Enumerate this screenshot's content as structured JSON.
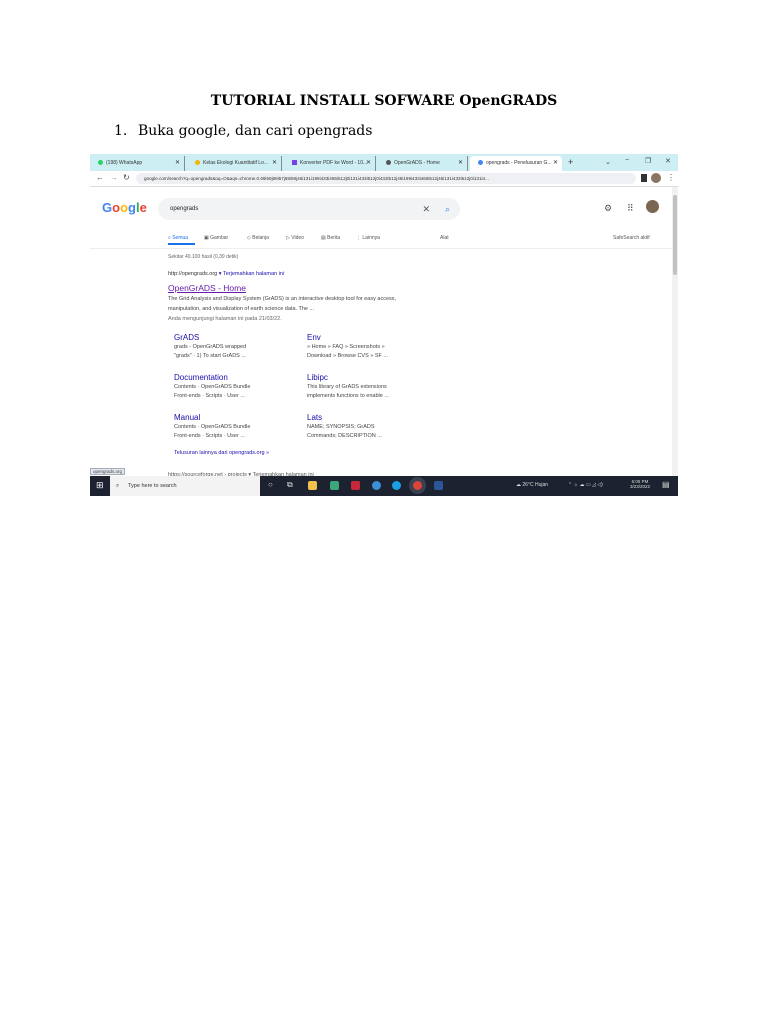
{
  "document": {
    "title": "TUTORIAL INSTALL SOFWARE OpenGRADS",
    "step_number": "1.",
    "step_text": "Buka google, dan cari opengrads"
  },
  "browser": {
    "tabs": [
      {
        "label": "(198) WhatsApp",
        "icon": "whatsapp-icon",
        "color": "#25d366"
      },
      {
        "label": "Kelas Ekologi Kuantitatif Lo...",
        "icon": "classroom-icon",
        "color": "#f4b400"
      },
      {
        "label": "Konverter PDF ke Word - 10...",
        "icon": "pdf-converter-icon",
        "color": "#7b3fe4"
      },
      {
        "label": "OpenGrADS - Home",
        "icon": "globe-icon",
        "color": "#555555"
      },
      {
        "label": "opengrads - Penelusuran G...",
        "icon": "google-icon",
        "color": "#4285f4"
      }
    ],
    "new_tab": "+",
    "window_controls": {
      "dropdown": "⌄",
      "minimize": "−",
      "restore": "❐",
      "close": "✕"
    },
    "url": "google.com/search?q=opengrads&oq=O&aqs=chrome.0.69i59j69i57j69i59j46i131i199i433i465i512j0i131i433i512j0i433i512j46i199i433i465i512j46i131i433i512j0i131i4..."
  },
  "google": {
    "logo": "Google",
    "query": "opengrads",
    "nav": [
      "Semua",
      "Gambar",
      "Belanja",
      "Video",
      "Berita",
      "Lainnya"
    ],
    "tools": "Alat",
    "safesearch": "SafeSearch aktif",
    "stats": "Sekitar 40.100 hasil (0,39 detik)",
    "result": {
      "url": "http://opengrads.org",
      "translate": "▾ Terjemahkan halaman ini",
      "title": "OpenGrADS - Home",
      "desc1": "The Grid Analysis and Display System (GrADS) is an interactive desktop tool for easy access,",
      "desc2": "manipulation, and visualization of earth science data. The ...",
      "visited": "Anda mengunjungi halaman ini pada 21/03/22."
    },
    "sitelinks": [
      {
        "title": "GrADS",
        "l1": "grads - OpenGrADS wrapped",
        "l2": "\"grads\" · 1) To start GrADS ..."
      },
      {
        "title": "Env",
        "l1": "» Home » FAQ » Screenshots »",
        "l2": "Download » Browse CVS » SF ..."
      },
      {
        "title": "Documentation",
        "l1": "Contents · OpenGrADS Bundle",
        "l2": "Front-ends · Scripts · User ..."
      },
      {
        "title": "Libipc",
        "l1": "This library of GrADS extensions",
        "l2": "implements functions to enable ..."
      },
      {
        "title": "Manual",
        "l1": "Contents · OpenGrADS Bundle",
        "l2": "Front-ends · Scripts · User ..."
      },
      {
        "title": "Lats",
        "l1": "NAME; SYNOPSIS; GrADS",
        "l2": "Commands; DESCRIPTION ..."
      }
    ],
    "more": "Telusuran lainnya dari opengrads.org »",
    "next_result": "https://sourceforge.net › projects  ▾ Terjemahkan halaman ini",
    "status_url": "opengrads.org"
  },
  "taskbar": {
    "search_placeholder": "Type here to search",
    "weather": "26°C  Hujan",
    "time": "6:06 PM",
    "date": "3/23/2022"
  }
}
